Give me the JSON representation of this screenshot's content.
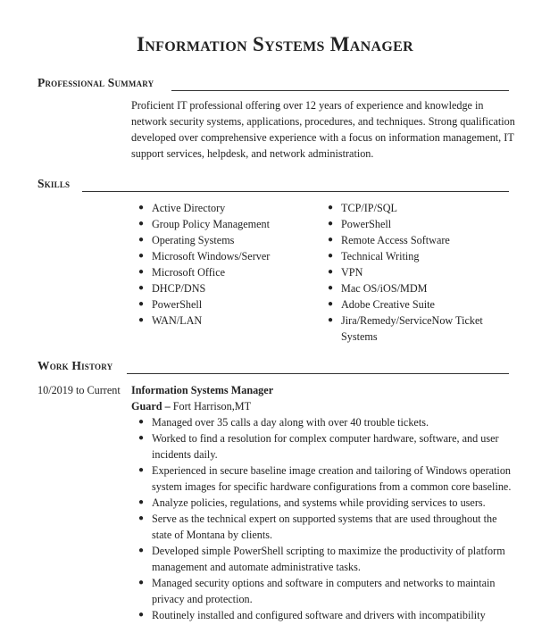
{
  "title": "Information Systems Manager",
  "sections": {
    "summary": {
      "heading": "Professional Summary",
      "text": "Proficient IT professional offering over 12 years of experience and knowledge in network security systems, applications, procedures, and techniques. Strong qualification developed over comprehensive experience with a focus on information management, IT support services, helpdesk, and network administration."
    },
    "skills": {
      "heading": "Skills",
      "left": [
        "Active Directory",
        "Group Policy Management",
        "Operating Systems",
        "Microsoft Windows/Server",
        "Microsoft Office",
        "DHCP/DNS",
        "PowerShell",
        "WAN/LAN"
      ],
      "right": [
        "TCP/IP/SQL",
        "PowerShell",
        "Remote Access Software",
        "Technical Writing",
        "VPN",
        "Mac OS/iOS/MDM",
        "Adobe Creative Suite",
        "Jira/Remedy/ServiceNow Ticket Systems"
      ]
    },
    "work_history": {
      "heading": "Work History",
      "jobs": [
        {
          "dates": "10/2019 to Current",
          "title": "Information Systems Manager",
          "company": "Guard",
          "separator": " – ",
          "location": "Fort Harrison,MT",
          "duties": [
            "Managed over 35 calls a day along with over 40 trouble tickets.",
            "Worked to find a resolution for complex computer hardware, software, and user incidents daily.",
            "Experienced in secure baseline image creation and tailoring of Windows operation system images for specific hardware configurations from a common core baseline.",
            "Analyze policies, regulations, and systems while providing services to users.",
            "Serve as the technical expert on supported systems that are used throughout the state of Montana by clients.",
            "Developed simple PowerShell scripting to maximize the productivity of platform management and automate administrative tasks.",
            "Managed security options and software in computers and networks to maintain privacy and protection.",
            "Routinely installed and configured software and drivers with incompatibility"
          ]
        }
      ]
    }
  },
  "bullet_glyph": "●"
}
